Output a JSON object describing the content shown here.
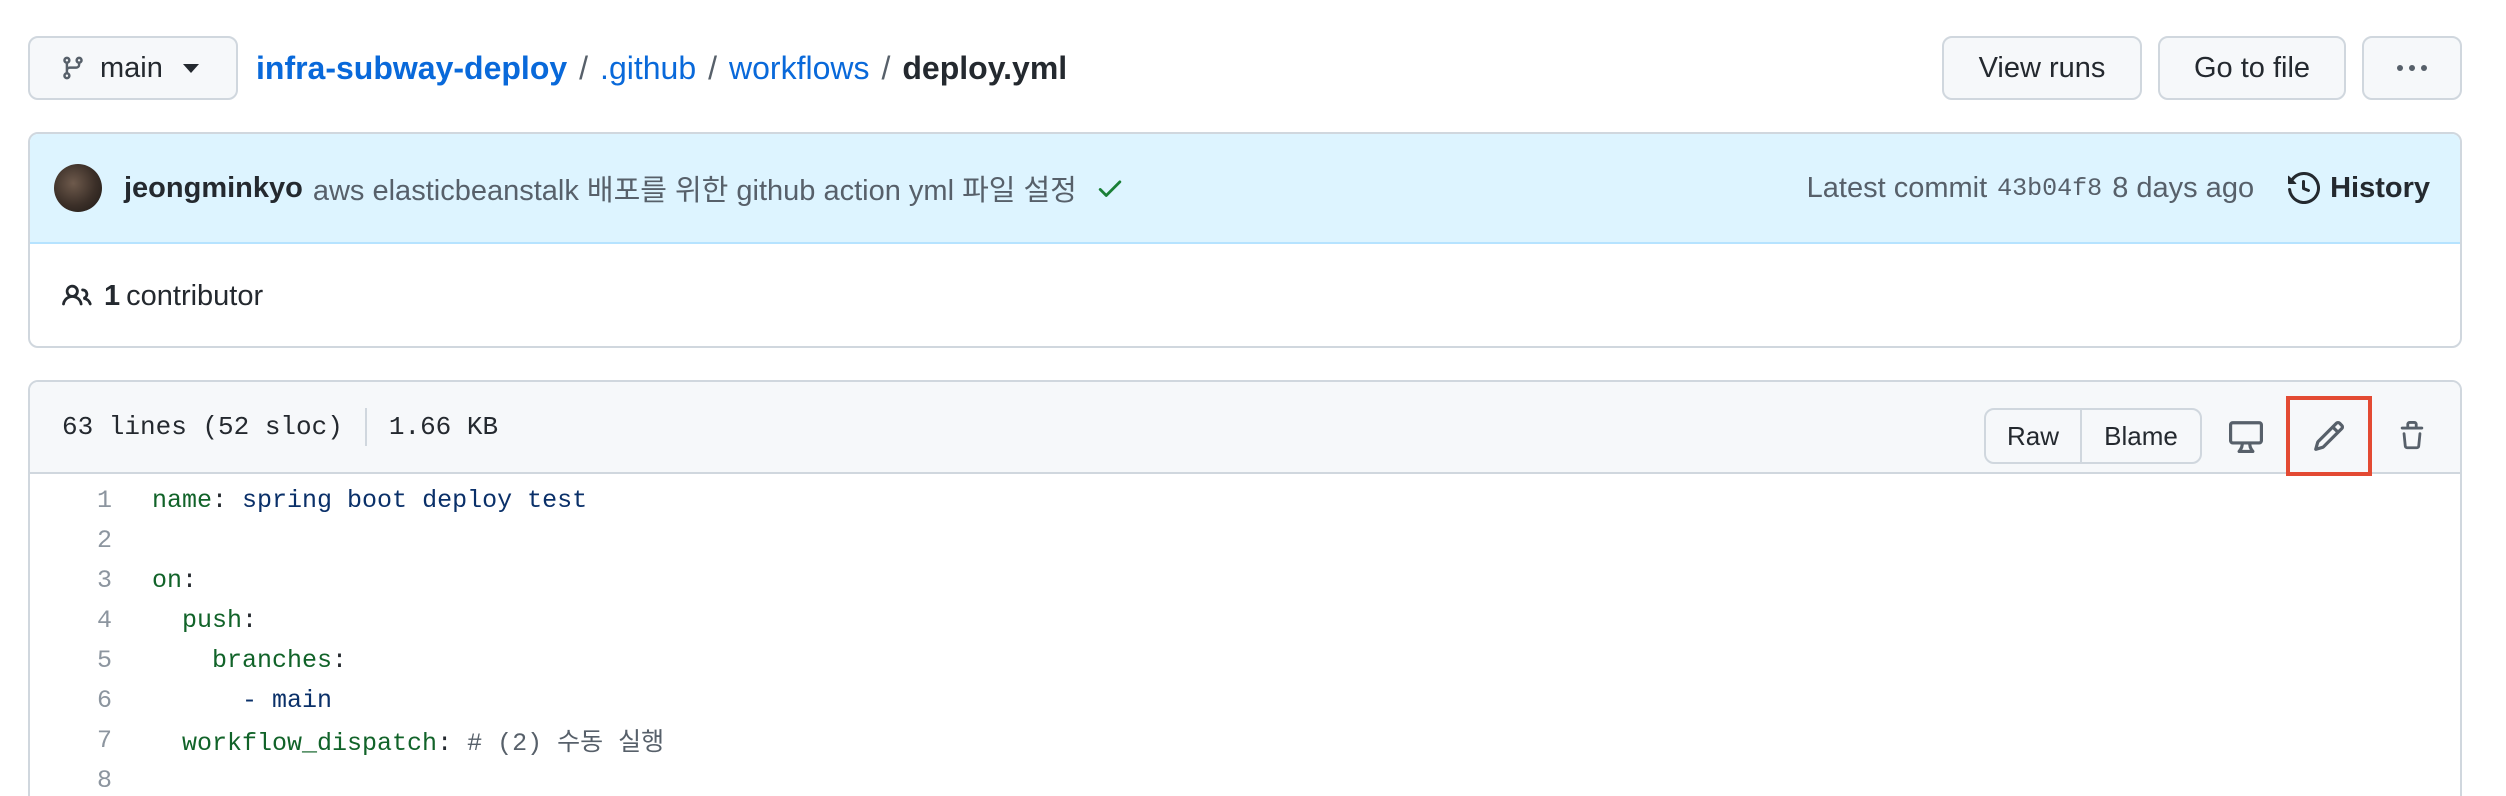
{
  "toolbar": {
    "branch": "main",
    "breadcrumb": {
      "repo": "infra-subway-deploy",
      "sep1": "/",
      "dir1": ".github",
      "sep2": "/",
      "dir2": "workflows",
      "sep3": "/",
      "file": "deploy.yml"
    },
    "view_runs": "View runs",
    "go_to_file": "Go to file"
  },
  "commit": {
    "author": "jeongminkyo",
    "message": "aws elasticbeanstalk 배포를 위한 github action yml 파일 설정",
    "latest_label": "Latest commit",
    "sha": "43b04f8",
    "time": "8 days ago",
    "history_label": "History",
    "contributor_count": "1",
    "contributor_label": "contributor"
  },
  "file": {
    "lines_info": "63 lines (52 sloc)",
    "size": "1.66 KB",
    "raw_label": "Raw",
    "blame_label": "Blame"
  },
  "code": [
    {
      "n": "1",
      "key": "name",
      "colon": ":",
      "value": " spring boot deploy test",
      "indent": ""
    },
    {
      "n": "2",
      "key": "",
      "colon": "",
      "value": "",
      "indent": ""
    },
    {
      "n": "3",
      "key": "on",
      "colon": ":",
      "value": "",
      "indent": ""
    },
    {
      "n": "4",
      "key": "push",
      "colon": ":",
      "value": "",
      "indent": "  "
    },
    {
      "n": "5",
      "key": "branches",
      "colon": ":",
      "value": "",
      "indent": "    "
    },
    {
      "n": "6",
      "key": "",
      "colon": "",
      "value": "- main",
      "indent": "      "
    },
    {
      "n": "7",
      "key": "workflow_dispatch",
      "colon": ":",
      "value": " # (2) 수동 실행",
      "indent": "  "
    },
    {
      "n": "8",
      "key": "",
      "colon": "",
      "value": "",
      "indent": ""
    }
  ],
  "colors": {
    "link": "#0969da",
    "commit_bg": "#ddf4ff",
    "highlight_border": "#e34a33",
    "yaml_key": "#116329",
    "yaml_value": "#0a3069"
  },
  "icons": [
    "git-branch-icon",
    "kebab-horizontal-icon",
    "check-icon",
    "history-icon",
    "people-icon",
    "desktop-icon",
    "pencil-icon",
    "trash-icon"
  ]
}
